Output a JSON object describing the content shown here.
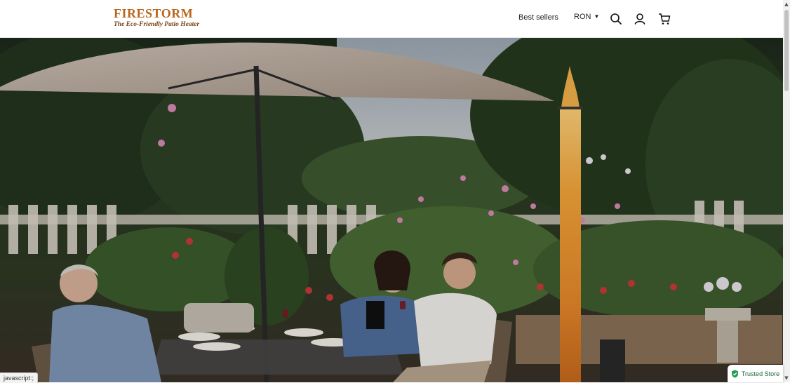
{
  "header": {
    "logo": {
      "name": "FIRESTORM",
      "tagline": "The Eco-Friendly Patio Heater"
    },
    "nav": {
      "best_sellers": "Best sellers"
    },
    "currency": {
      "selected": "RON"
    },
    "icons": [
      "search-icon",
      "account-icon",
      "cart-icon"
    ]
  },
  "hero": {
    "alt_subject": "Family seated at patio table beside flaming outdoor heater column under garden umbrella"
  },
  "status_bar": {
    "text": "javascript:;"
  },
  "trust_badge": {
    "label": "Trusted Store"
  },
  "colors": {
    "brand": "#b8651c",
    "brand_dark": "#7a3e0e",
    "trust_green": "#1a6b3a"
  }
}
